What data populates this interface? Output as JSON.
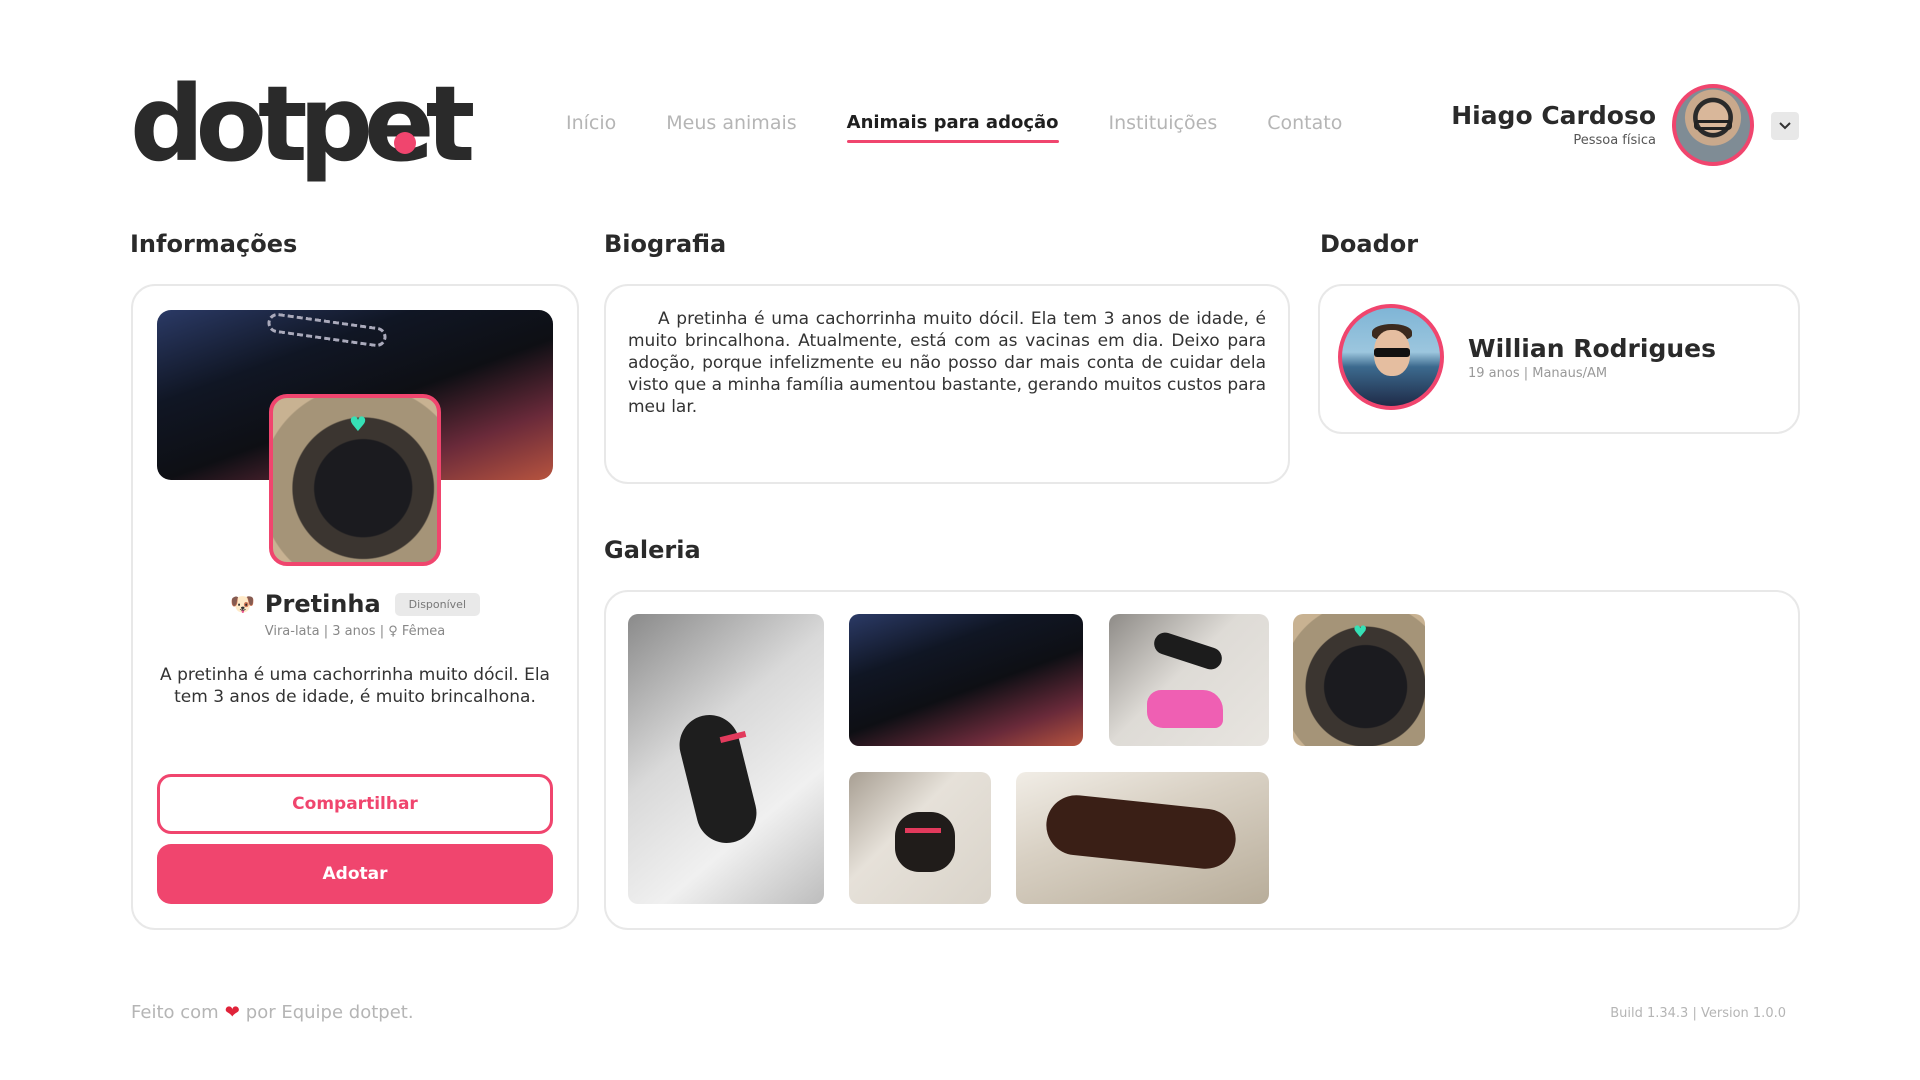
{
  "brand": {
    "logo_text": "dotpet",
    "accent_color": "#f0456e"
  },
  "nav": {
    "items": [
      {
        "label": "Início"
      },
      {
        "label": "Meus animais"
      },
      {
        "label": "Animais para adoção",
        "active": true
      },
      {
        "label": "Instituições"
      },
      {
        "label": "Contato"
      }
    ]
  },
  "user": {
    "name": "Hiago Cardoso",
    "type": "Pessoa física",
    "menu_icon": "chevron-down-icon"
  },
  "sections": {
    "info_title": "Informações",
    "bio_title": "Biografia",
    "donor_title": "Doador",
    "gallery_title": "Galeria"
  },
  "pet": {
    "emoji": "🐶",
    "name": "Pretinha",
    "status": "Disponível",
    "meta": "Vira-lata | 3 anos | ♀ Fêmea",
    "description": "A pretinha é uma cachorrinha muito dócil. Ela tem 3 anos de idade, é muito brincalhona.",
    "share_label": "Compartilhar",
    "adopt_label": "Adotar"
  },
  "bio": {
    "text": "A pretinha é uma cachorrinha muito dócil. Ela tem 3 anos de idade, é muito brincalhona. Atualmente, está com as vacinas em dia. Deixo para adoção, porque infelizmente eu não posso dar mais conta de cuidar dela visto que a minha família aumentou bastante, gerando muitos custos para meu lar."
  },
  "donor": {
    "name": "Willian Rodrigues",
    "meta": "19 anos | Manaus/AM"
  },
  "gallery": {
    "count": 6
  },
  "footer": {
    "left_prefix": "Feito com",
    "left_suffix": "por Equipe dotpet.",
    "build": "Build 1.34.3 | Version 1.0.0"
  }
}
